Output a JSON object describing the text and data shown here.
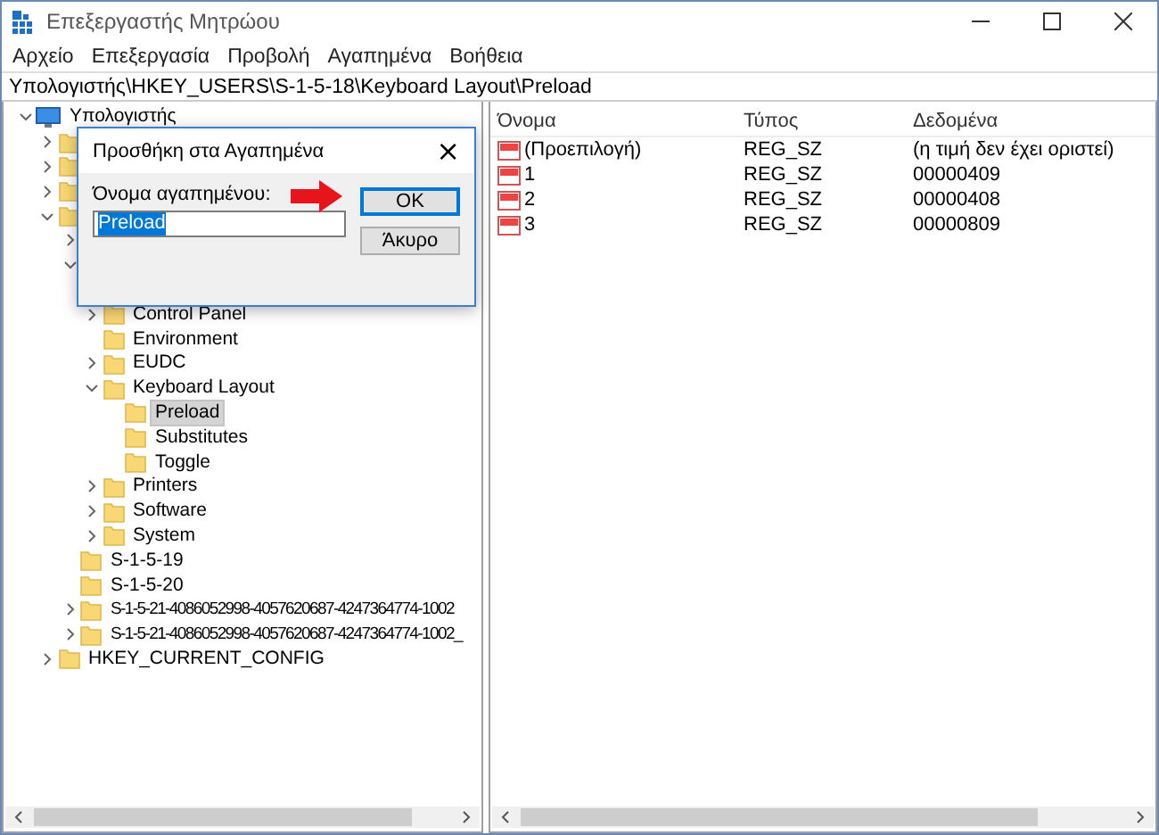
{
  "window": {
    "title": "Επεξεργαστής Μητρώου"
  },
  "menu": [
    "Αρχείο",
    "Επεξεργασία",
    "Προβολή",
    "Αγαπημένα",
    "Βοήθεια"
  ],
  "address": "Υπολογιστής\\HKEY_USERS\\S-1-5-18\\Keyboard Layout\\Preload",
  "tree": {
    "label": "Υπολογιστής",
    "expanded": true,
    "selected": false,
    "children": [
      {
        "expanded": false,
        "selected": false
      },
      {
        "expanded": false,
        "selected": false
      },
      {
        "expanded": false,
        "selected": false
      },
      {
        "expanded": true,
        "selected": false,
        "children": [
          {
            "expanded": false,
            "selected": false
          },
          {
            "expanded": true,
            "selected": false,
            "children": [
              {
                "selected": false
              },
              {
                "label": "Control Panel",
                "expanded": false,
                "selected": false
              },
              {
                "label": "Environment",
                "selected": false
              },
              {
                "label": "EUDC",
                "expanded": false,
                "selected": false
              },
              {
                "label": "Keyboard Layout",
                "expanded": true,
                "selected": false,
                "children": [
                  {
                    "label": "Preload",
                    "selected": true
                  },
                  {
                    "label": "Substitutes",
                    "selected": false
                  },
                  {
                    "label": "Toggle",
                    "selected": false
                  }
                ]
              },
              {
                "label": "Printers",
                "expanded": false,
                "selected": false
              },
              {
                "label": "Software",
                "expanded": false,
                "selected": false
              },
              {
                "label": "System",
                "expanded": false,
                "selected": false
              }
            ]
          },
          {
            "label": "S-1-5-19",
            "selected": false
          },
          {
            "label": "S-1-5-20",
            "selected": false
          },
          {
            "label": "S-1-5-21-4086052998-4057620687-4247364774-1002",
            "expanded": false,
            "selected": false
          },
          {
            "label": "S-1-5-21-4086052998-4057620687-4247364774-1002_",
            "expanded": false,
            "selected": false
          }
        ]
      },
      {
        "label": "HKEY_CURRENT_CONFIG",
        "expanded": false,
        "selected": false
      }
    ]
  },
  "table": {
    "columns": [
      "Όνομα",
      "Τύπος",
      "Δεδομένα"
    ],
    "rows": [
      [
        "(Προεπιλογή)",
        "REG_SZ",
        "(η τιμή δεν έχει οριστεί)"
      ],
      [
        "1",
        "REG_SZ",
        "00000409"
      ],
      [
        "2",
        "REG_SZ",
        "00000408"
      ],
      [
        "3",
        "REG_SZ",
        "00000809"
      ]
    ]
  },
  "dialog": {
    "title": "Προσθήκη στα Αγαπημένα",
    "close": "×",
    "label": "Όνομα αγαπημένου:",
    "value": "Preload",
    "buttons": [
      "OK",
      "Άκυρο"
    ]
  }
}
